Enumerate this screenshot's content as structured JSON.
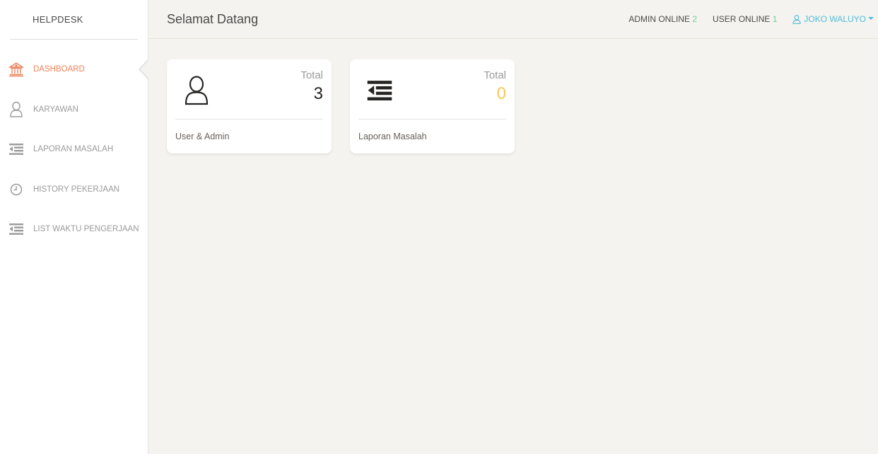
{
  "sidebar": {
    "brand": "HELPDESK",
    "items": [
      {
        "label": "DASHBOARD",
        "icon": "bank-icon",
        "active": true
      },
      {
        "label": "KARYAWAN",
        "icon": "user-icon",
        "active": false
      },
      {
        "label": "LAPORAN MASALAH",
        "icon": "list-indent-icon",
        "active": false
      },
      {
        "label": "HISTORY PEKERJAAN",
        "icon": "clock-icon",
        "active": false
      },
      {
        "label": "LIST WAKTU PENGERJAAN",
        "icon": "list-indent-icon",
        "active": false
      }
    ]
  },
  "header": {
    "title": "Selamat Datang",
    "admin_online_label": "ADMIN ONLINE",
    "admin_online_count": "2",
    "user_online_label": "USER ONLINE",
    "user_online_count": "1",
    "user_name": "JOKO WALUYO"
  },
  "cards": [
    {
      "icon": "user-icon",
      "total_label": "Total",
      "value": "3",
      "footer": "User & Admin"
    },
    {
      "icon": "list-indent-icon",
      "total_label": "Total",
      "value": "0",
      "footer": "Laporan Masalah"
    }
  ],
  "colors": {
    "accent_orange": "#ef8157",
    "online_green": "#6bd098",
    "user_blue": "#51bcda",
    "warning_yellow": "#fbc658"
  }
}
